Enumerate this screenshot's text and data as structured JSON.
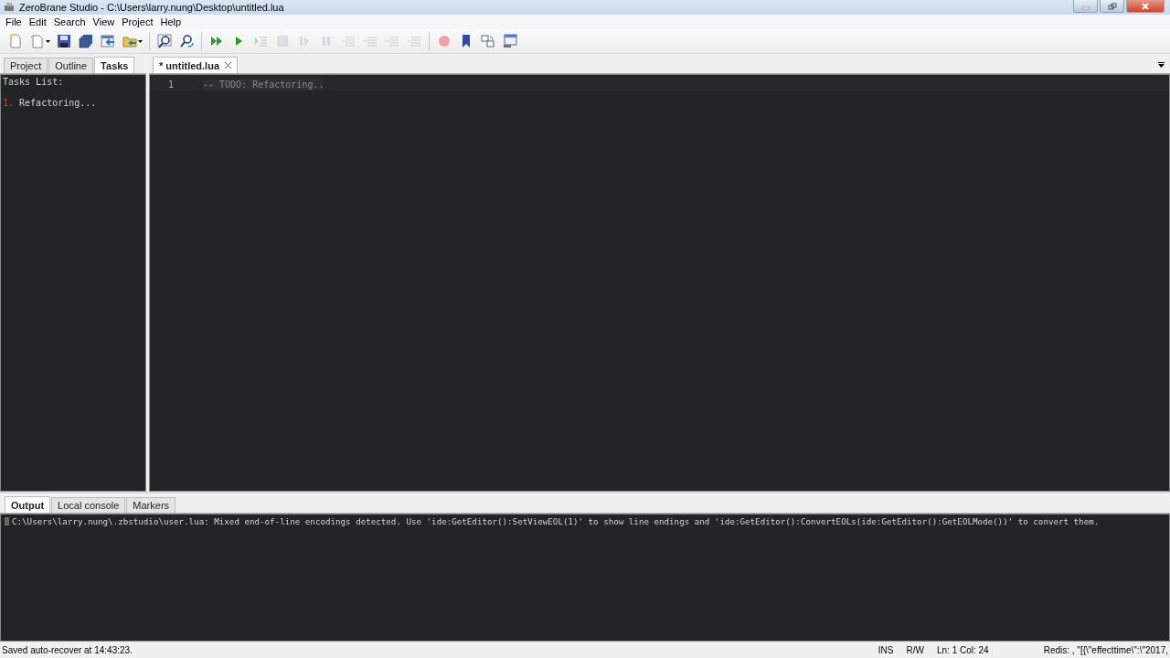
{
  "window": {
    "title": "ZeroBrane Studio - C:\\Users\\larry.nung\\Desktop\\untitled.lua"
  },
  "menu": [
    "File",
    "Edit",
    "Search",
    "View",
    "Project",
    "Help"
  ],
  "toolbar": [
    {
      "kind": "new",
      "disabled": false
    },
    {
      "kind": "open",
      "disabled": false,
      "dropdown": true
    },
    {
      "kind": "save",
      "disabled": false
    },
    {
      "kind": "saveall",
      "disabled": false
    },
    {
      "kind": "project",
      "disabled": false
    },
    {
      "kind": "folder",
      "disabled": false,
      "dropdown": true
    },
    {
      "kind": "sep"
    },
    {
      "kind": "find",
      "disabled": false
    },
    {
      "kind": "replace",
      "disabled": false
    },
    {
      "kind": "sep"
    },
    {
      "kind": "run",
      "disabled": false
    },
    {
      "kind": "play",
      "disabled": false
    },
    {
      "kind": "stepinto",
      "disabled": true
    },
    {
      "kind": "stop",
      "disabled": true
    },
    {
      "kind": "stepover",
      "disabled": true
    },
    {
      "kind": "pause",
      "disabled": true
    },
    {
      "kind": "lines",
      "disabled": true
    },
    {
      "kind": "lines",
      "disabled": true
    },
    {
      "kind": "lines",
      "disabled": true
    },
    {
      "kind": "lines",
      "disabled": true
    },
    {
      "kind": "sep"
    },
    {
      "kind": "breakpoint",
      "disabled": false
    },
    {
      "kind": "bookmark",
      "disabled": false
    },
    {
      "kind": "windows",
      "disabled": false
    },
    {
      "kind": "monitor",
      "disabled": false
    }
  ],
  "sidebar": {
    "tabs": [
      {
        "label": "Project",
        "selected": false
      },
      {
        "label": "Outline",
        "selected": false
      },
      {
        "label": "Tasks",
        "selected": true
      }
    ],
    "heading": "Tasks List:",
    "tasks": [
      {
        "number": "1.",
        "text": "Refactoring..."
      }
    ]
  },
  "editor": {
    "tabs": [
      {
        "label": "* untitled.lua",
        "selected": true
      }
    ],
    "lines": [
      {
        "number": "1",
        "text": "-- TODO: Refactoring..",
        "current": true
      }
    ]
  },
  "bottom_panel": {
    "tabs": [
      {
        "label": "Output",
        "selected": true
      },
      {
        "label": "Local console",
        "selected": false
      },
      {
        "label": "Markers",
        "selected": false
      }
    ],
    "output": [
      "C:\\Users\\larry.nung\\.zbstudio\\user.lua: Mixed end-of-line encodings detected. Use 'ide:GetEditor():SetViewEOL(1)' to show line endings and 'ide:GetEditor():ConvertEOLs(ide:GetEditor():GetEOLMode())' to convert them."
    ]
  },
  "status_bar": {
    "message": "Saved auto-recover at 14:43:23.",
    "mode": "INS",
    "access": "R/W",
    "position": "Ln: 1 Col: 24",
    "extra": "Redis: , \"[{\\\"effecttime\\\":\\\"2017,"
  }
}
